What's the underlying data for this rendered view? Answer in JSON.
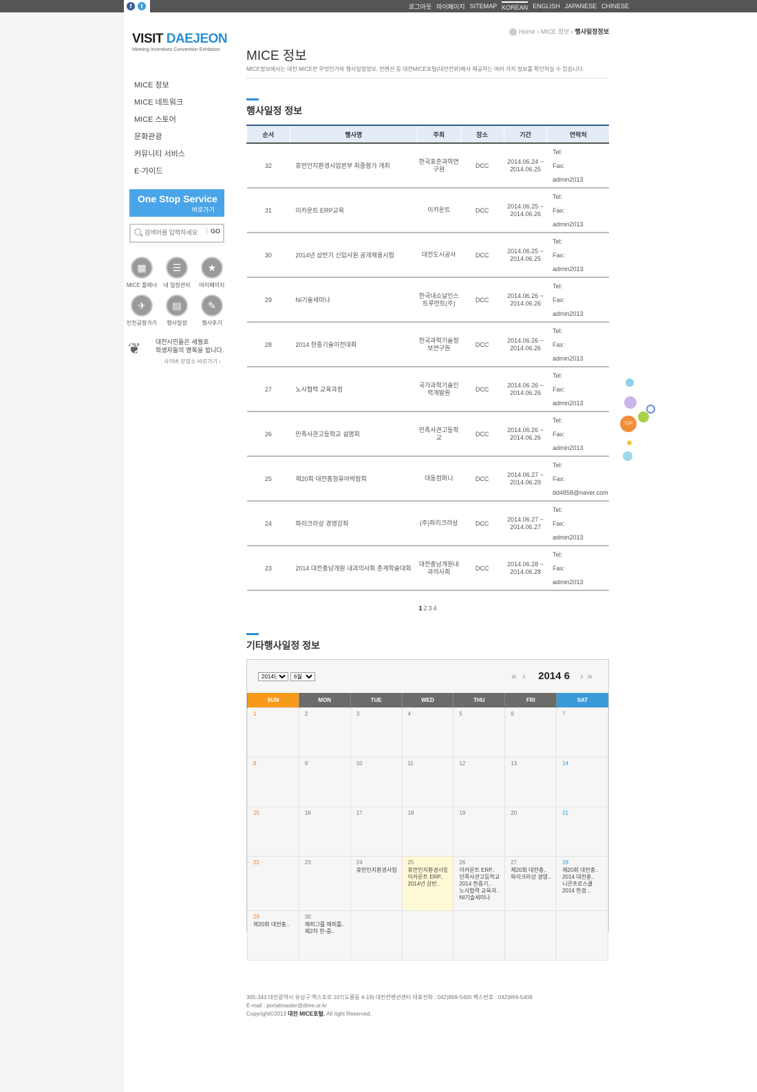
{
  "top_links": [
    "로그아웃",
    "마이페이지",
    "SITEMAP",
    "KOREAN",
    "ENGLISH",
    "JAPANESE",
    "CHINESE"
  ],
  "logo": {
    "title_a": "VISIT ",
    "title_b": "DAEJEON",
    "subtitle": "Meeting Incentives Convention Exhibition"
  },
  "menu": [
    "MICE 정보",
    "MICE 네트워크",
    "MICE 스토어",
    "문화관광",
    "커뮤니티 서비스",
    "E-가이드"
  ],
  "one_stop": {
    "title": "One Stop Service",
    "sub": "바로가기"
  },
  "search": {
    "placeholder": "검색어를 입력하세요",
    "go": "GO"
  },
  "quick_icons": [
    "MICE 플래너",
    "내 일정관리",
    "마이페이지",
    "인천공항가기",
    "행사일정",
    "행사후기"
  ],
  "cyber": {
    "line1": "대전시민들은 세월호",
    "line2": "희생자들의 명복을 빕니다.",
    "link": "사이버 분향소 바로가기 ›"
  },
  "breadcrumb": {
    "home": "Home",
    "mid": "MICE 정보",
    "current": "행사일정정보"
  },
  "page": {
    "title": "MICE 정보",
    "desc": "MICE정보에서는 대전 MICE란 무엇인가와 행사일정정보, 컨벤션 등 대전MICE포털(대전컨뷰)에서 제공하는 여러 가지 정보를 확인하실 수 있습니다."
  },
  "section1": "행사일정 정보",
  "table": {
    "headers": [
      "순서",
      "행사명",
      "주최",
      "장소",
      "기간",
      "연락처"
    ],
    "contact_labels": {
      "tel": "Tel:",
      "fax": "Fax:"
    },
    "rows": [
      {
        "no": "32",
        "name": "휴먼인지환경사업본부 최종평가 개최",
        "host": "한국표준과학연구원",
        "place": "DCC",
        "period": "2014.06.24 ~ 2014.06.25",
        "email": "admin2013"
      },
      {
        "no": "31",
        "name": "이카운트 ERP교육",
        "host": "이카운트",
        "place": "DCC",
        "period": "2014.06.25 ~ 2014.06.26",
        "email": "admin2013"
      },
      {
        "no": "30",
        "name": "2014년 상반기 신입사원 공개채용시험",
        "host": "대전도시공사",
        "place": "DCC",
        "period": "2014.06.25 ~ 2014.06.25",
        "email": "admin2013"
      },
      {
        "no": "29",
        "name": "NI기술세미나",
        "host": "한국내쇼날인스트루먼트(주)",
        "place": "DCC",
        "period": "2014.06.26 ~ 2014.06.26",
        "email": "admin2013"
      },
      {
        "no": "28",
        "name": "2014 한중기술이전대회",
        "host": "한국과학기술정보연구원",
        "place": "DCC",
        "period": "2014.06.26 ~ 2014.06.26",
        "email": "admin2013"
      },
      {
        "no": "27",
        "name": "노사협력 교육과정",
        "host": "국가과학기술인력개발원",
        "place": "DCC",
        "period": "2014.06.26 ~ 2014.06.26",
        "email": "admin2013"
      },
      {
        "no": "26",
        "name": "민족사관고등학교 설명회",
        "host": "민족사관고등학교",
        "place": "DCC",
        "period": "2014.06.26 ~ 2014.06.26",
        "email": "admin2013"
      },
      {
        "no": "25",
        "name": "제20회 대전충청유아박람회",
        "host": "대동컴퍼니",
        "place": "DCC",
        "period": "2014.06.27 ~ 2014.06.29",
        "email": "dd4858@naver.com"
      },
      {
        "no": "24",
        "name": "파리크라상 경영강좌",
        "host": "(주)파리크라상",
        "place": "DCC",
        "period": "2014.06.27 ~ 2014.06.27",
        "email": "admin2013"
      },
      {
        "no": "23",
        "name": "2014 대전충남개원 내과의사회 춘계학술대회",
        "host": "대전충남개원내과의사회",
        "place": "DCC",
        "period": "2014.06.28 ~ 2014.06.28",
        "email": "admin2013"
      }
    ]
  },
  "pager": [
    "1",
    "2",
    "3",
    "4"
  ],
  "section2": "기타행사일정 정보",
  "calendar": {
    "year_option": "2014년",
    "month_option": "6월",
    "title": "2014 6",
    "days": [
      "SUN",
      "MON",
      "TUE",
      "WED",
      "THU",
      "FRI",
      "SAT"
    ],
    "nav": {
      "first": "«",
      "prev": "‹",
      "next": "›",
      "last": "»"
    },
    "weeks": [
      [
        {
          "d": "1"
        },
        {
          "d": "2"
        },
        {
          "d": "3"
        },
        {
          "d": "4"
        },
        {
          "d": "5"
        },
        {
          "d": "6"
        },
        {
          "d": "7"
        }
      ],
      [
        {
          "d": "8"
        },
        {
          "d": "9"
        },
        {
          "d": "10"
        },
        {
          "d": "11"
        },
        {
          "d": "12"
        },
        {
          "d": "13"
        },
        {
          "d": "14"
        }
      ],
      [
        {
          "d": "15"
        },
        {
          "d": "16"
        },
        {
          "d": "17"
        },
        {
          "d": "18"
        },
        {
          "d": "19"
        },
        {
          "d": "20"
        },
        {
          "d": "21"
        }
      ],
      [
        {
          "d": "22"
        },
        {
          "d": "23"
        },
        {
          "d": "24",
          "e": [
            "휴먼인지환경사업.."
          ]
        },
        {
          "d": "25",
          "e": [
            "휴먼인지환경사업..",
            "이카운트 ERP..",
            "2014년 상반.."
          ]
        },
        {
          "d": "26",
          "e": [
            "이카운트 ERP..",
            "민족사관고등학교..",
            "2014 한중기..",
            "노사협력 교육과..",
            "NI기술세미나"
          ]
        },
        {
          "d": "27",
          "e": [
            "제20회 대전충..",
            "파리크라상 경영.."
          ]
        },
        {
          "d": "28",
          "e": [
            "제20회 대전충..",
            "2014 대전충..",
            "니콘프로스쿨",
            "2014 한경 .."
          ]
        }
      ],
      [
        {
          "d": "29",
          "e": [
            "제20회 대전충.."
          ]
        },
        {
          "d": "30",
          "e": [
            "해피그룹 해피틀..",
            "제2차 한-중.."
          ]
        },
        {
          "d": ""
        },
        {
          "d": ""
        },
        {
          "d": ""
        },
        {
          "d": ""
        },
        {
          "d": ""
        }
      ]
    ]
  },
  "footer": {
    "line1": "305-343 대전광역시 유성구 엑스포로 107(도룡동 4-19) 대전컨벤션센터 대표전화 : 042)869-5400 팩스번호 : 042)869-5409",
    "line2": "E-mail : portalmaster@dime.or.kr",
    "line3a": "Copyright©2013 ",
    "line3b": "대전 MICE포털.",
    "line3c": " All right Reserved."
  },
  "top_widget": "TOP",
  "colors": {
    "accent": "#2b8ed4",
    "header_bg": "#555555",
    "sunday": "#f79a1b",
    "saturday": "#3a9ad9",
    "today": "#fffad6"
  }
}
